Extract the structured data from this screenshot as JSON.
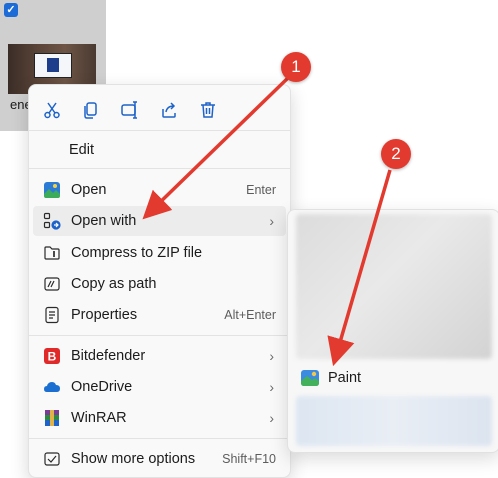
{
  "file": {
    "name": "ene"
  },
  "menu": {
    "toolbar": [
      {
        "icon": "cut-icon"
      },
      {
        "icon": "copy-icon"
      },
      {
        "icon": "rename-icon"
      },
      {
        "icon": "share-icon"
      },
      {
        "icon": "delete-icon"
      }
    ],
    "edit_label": "Edit",
    "items": [
      {
        "label": "Open",
        "shortcut": "Enter",
        "icon": "photos-icon"
      },
      {
        "label": "Open with",
        "icon": "open-with-icon",
        "arrow": "›"
      },
      {
        "label": "Compress to ZIP file",
        "icon": "zip-icon"
      },
      {
        "label": "Copy as path",
        "icon": "copy-path-icon"
      },
      {
        "label": "Properties",
        "shortcut": "Alt+Enter",
        "icon": "properties-icon"
      },
      {
        "label": "Bitdefender",
        "icon": "bitdefender-icon",
        "arrow": "›"
      },
      {
        "label": "OneDrive",
        "icon": "onedrive-icon",
        "arrow": "›"
      },
      {
        "label": "WinRAR",
        "icon": "winrar-icon",
        "arrow": "›"
      },
      {
        "label": "Show more options",
        "shortcut": "Shift+F10",
        "icon": "more-options-icon"
      }
    ]
  },
  "submenu": {
    "paint_label": "Paint",
    "icon": "paint-icon"
  },
  "annotations": {
    "badge1": "1",
    "badge2": "2",
    "color": "#e23a2e"
  }
}
